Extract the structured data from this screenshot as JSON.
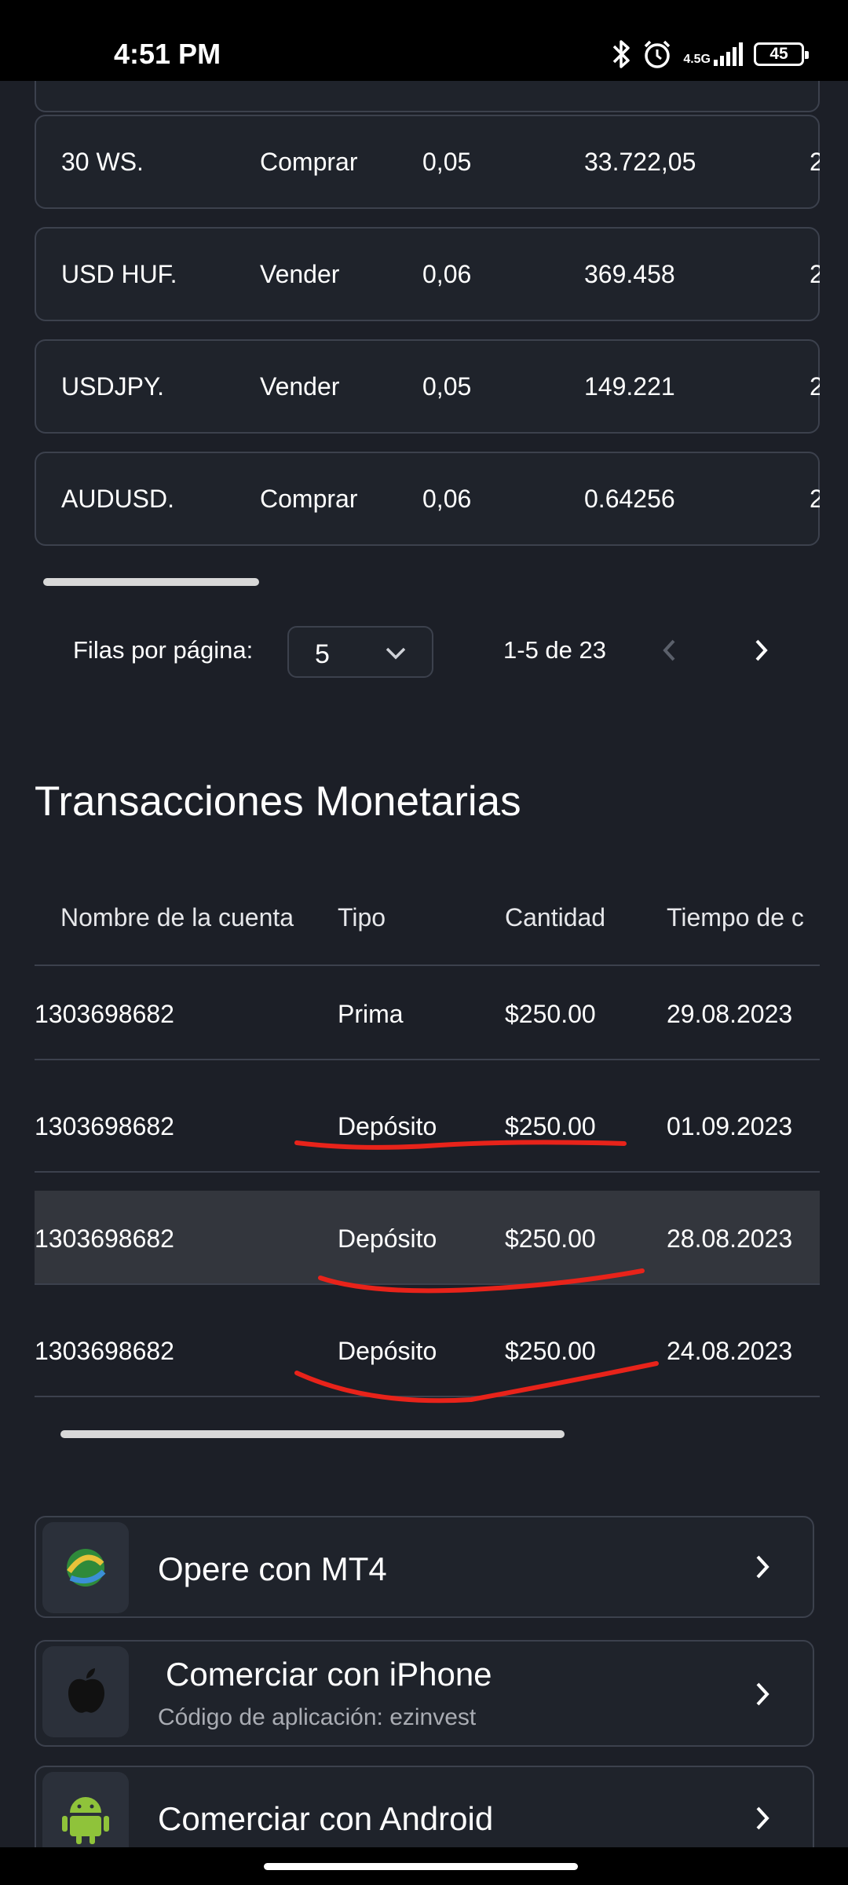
{
  "status_bar": {
    "time": "4:51 PM",
    "network": "4.5G",
    "battery": "45"
  },
  "trades": [
    {
      "symbol": "30 WS.",
      "type": "Comprar",
      "volume": "0,05",
      "price": "33.722,05",
      "extra": "2"
    },
    {
      "symbol": "USD HUF.",
      "type": "Vender",
      "volume": "0,06",
      "price": "369.458",
      "extra": "2"
    },
    {
      "symbol": "USDJPY.",
      "type": "Vender",
      "volume": "0,05",
      "price": "149.221",
      "extra": "2"
    },
    {
      "symbol": "AUDUSD.",
      "type": "Comprar",
      "volume": "0,06",
      "price": "0.64256",
      "extra": "2"
    }
  ],
  "pagination": {
    "rows_label": "Filas por página:",
    "rows_value": "5",
    "range": "1-5 de 23"
  },
  "money": {
    "title": "Transacciones Monetarias",
    "headers": [
      "Nombre de la cuenta",
      "Tipo",
      "Cantidad",
      "Tiempo de c"
    ],
    "rows": [
      {
        "account": "1303698682",
        "type": "Prima",
        "amount": "$250.00",
        "date": "29.08.2023"
      },
      {
        "account": "1303698682",
        "type": "Depósito",
        "amount": "$250.00",
        "date": "01.09.2023"
      },
      {
        "account": "1303698682",
        "type": "Depósito",
        "amount": "$250.00",
        "date": "28.08.2023"
      },
      {
        "account": "1303698682",
        "type": "Depósito",
        "amount": "$250.00",
        "date": "24.08.2023"
      }
    ]
  },
  "apps": {
    "mt4": {
      "title": "Opere con MT4"
    },
    "iphone": {
      "title": "Comerciar con iPhone",
      "subtitle": "Código de aplicación: ezinvest"
    },
    "android": {
      "title": "Comerciar con Android"
    }
  },
  "colors": {
    "background": "#1c1f27",
    "card_border": "#3c414d",
    "highlight_row": "#33363d",
    "annotation_red": "#e8231a"
  }
}
